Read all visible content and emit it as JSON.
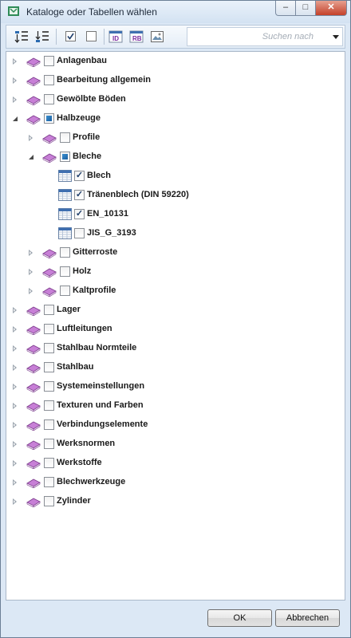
{
  "window": {
    "title": "Kataloge oder Tabellen wählen",
    "buttons": {
      "minimize": "–",
      "maximize": "□",
      "close": "✕"
    }
  },
  "toolbar": {
    "icons": [
      "expand-all-icon",
      "collapse-all-icon",
      "check-all-icon",
      "uncheck-all-icon",
      "table-id-icon",
      "table-rb-icon",
      "image-icon"
    ],
    "search_placeholder": "Suchen nach"
  },
  "tree": {
    "rows": [
      {
        "label": "Anlagenbau",
        "level": 0,
        "kind": "catalog",
        "expander": "collapsed",
        "check": "unchecked"
      },
      {
        "label": "Bearbeitung allgemein",
        "level": 0,
        "kind": "catalog",
        "expander": "collapsed",
        "check": "unchecked"
      },
      {
        "label": "Gewölbte Böden",
        "level": 0,
        "kind": "catalog",
        "expander": "collapsed",
        "check": "unchecked"
      },
      {
        "label": "Halbzeuge",
        "level": 0,
        "kind": "catalog",
        "expander": "expanded",
        "check": "partial"
      },
      {
        "label": "Profile",
        "level": 1,
        "kind": "catalog",
        "expander": "collapsed",
        "check": "unchecked"
      },
      {
        "label": "Bleche",
        "level": 1,
        "kind": "catalog",
        "expander": "expanded",
        "check": "partial"
      },
      {
        "label": "Blech",
        "level": 2,
        "kind": "table",
        "expander": "none",
        "check": "checked"
      },
      {
        "label": "Tränenblech (DIN 59220)",
        "level": 2,
        "kind": "table",
        "expander": "none",
        "check": "checked"
      },
      {
        "label": "EN_10131",
        "level": 2,
        "kind": "table",
        "expander": "none",
        "check": "checked"
      },
      {
        "label": "JIS_G_3193",
        "level": 2,
        "kind": "table",
        "expander": "none",
        "check": "unchecked"
      },
      {
        "label": "Gitterroste",
        "level": 1,
        "kind": "catalog",
        "expander": "collapsed",
        "check": "unchecked"
      },
      {
        "label": "Holz",
        "level": 1,
        "kind": "catalog",
        "expander": "collapsed",
        "check": "unchecked"
      },
      {
        "label": "Kaltprofile",
        "level": 1,
        "kind": "catalog",
        "expander": "collapsed",
        "check": "unchecked"
      },
      {
        "label": "Lager",
        "level": 0,
        "kind": "catalog",
        "expander": "collapsed",
        "check": "unchecked"
      },
      {
        "label": "Luftleitungen",
        "level": 0,
        "kind": "catalog",
        "expander": "collapsed",
        "check": "unchecked"
      },
      {
        "label": "Stahlbau Normteile",
        "level": 0,
        "kind": "catalog",
        "expander": "collapsed",
        "check": "unchecked"
      },
      {
        "label": "Stahlbau",
        "level": 0,
        "kind": "catalog",
        "expander": "collapsed",
        "check": "unchecked"
      },
      {
        "label": "Systemeinstellungen",
        "level": 0,
        "kind": "catalog",
        "expander": "collapsed",
        "check": "unchecked"
      },
      {
        "label": "Texturen und Farben",
        "level": 0,
        "kind": "catalog",
        "expander": "collapsed",
        "check": "unchecked"
      },
      {
        "label": "Verbindungselemente",
        "level": 0,
        "kind": "catalog",
        "expander": "collapsed",
        "check": "unchecked"
      },
      {
        "label": "Werksnormen",
        "level": 0,
        "kind": "catalog",
        "expander": "collapsed",
        "check": "unchecked"
      },
      {
        "label": "Werkstoffe",
        "level": 0,
        "kind": "catalog",
        "expander": "collapsed",
        "check": "unchecked"
      },
      {
        "label": "Blechwerkzeuge",
        "level": 0,
        "kind": "catalog",
        "expander": "collapsed",
        "check": "unchecked"
      },
      {
        "label": "Zylinder",
        "level": 0,
        "kind": "catalog",
        "expander": "collapsed",
        "check": "unchecked"
      }
    ]
  },
  "footer": {
    "ok_label": "OK",
    "cancel_label": "Abbrechen"
  },
  "colors": {
    "book": "#c77fd6",
    "table_header": "#3f6fb0",
    "accent": "#1b5fa0"
  }
}
